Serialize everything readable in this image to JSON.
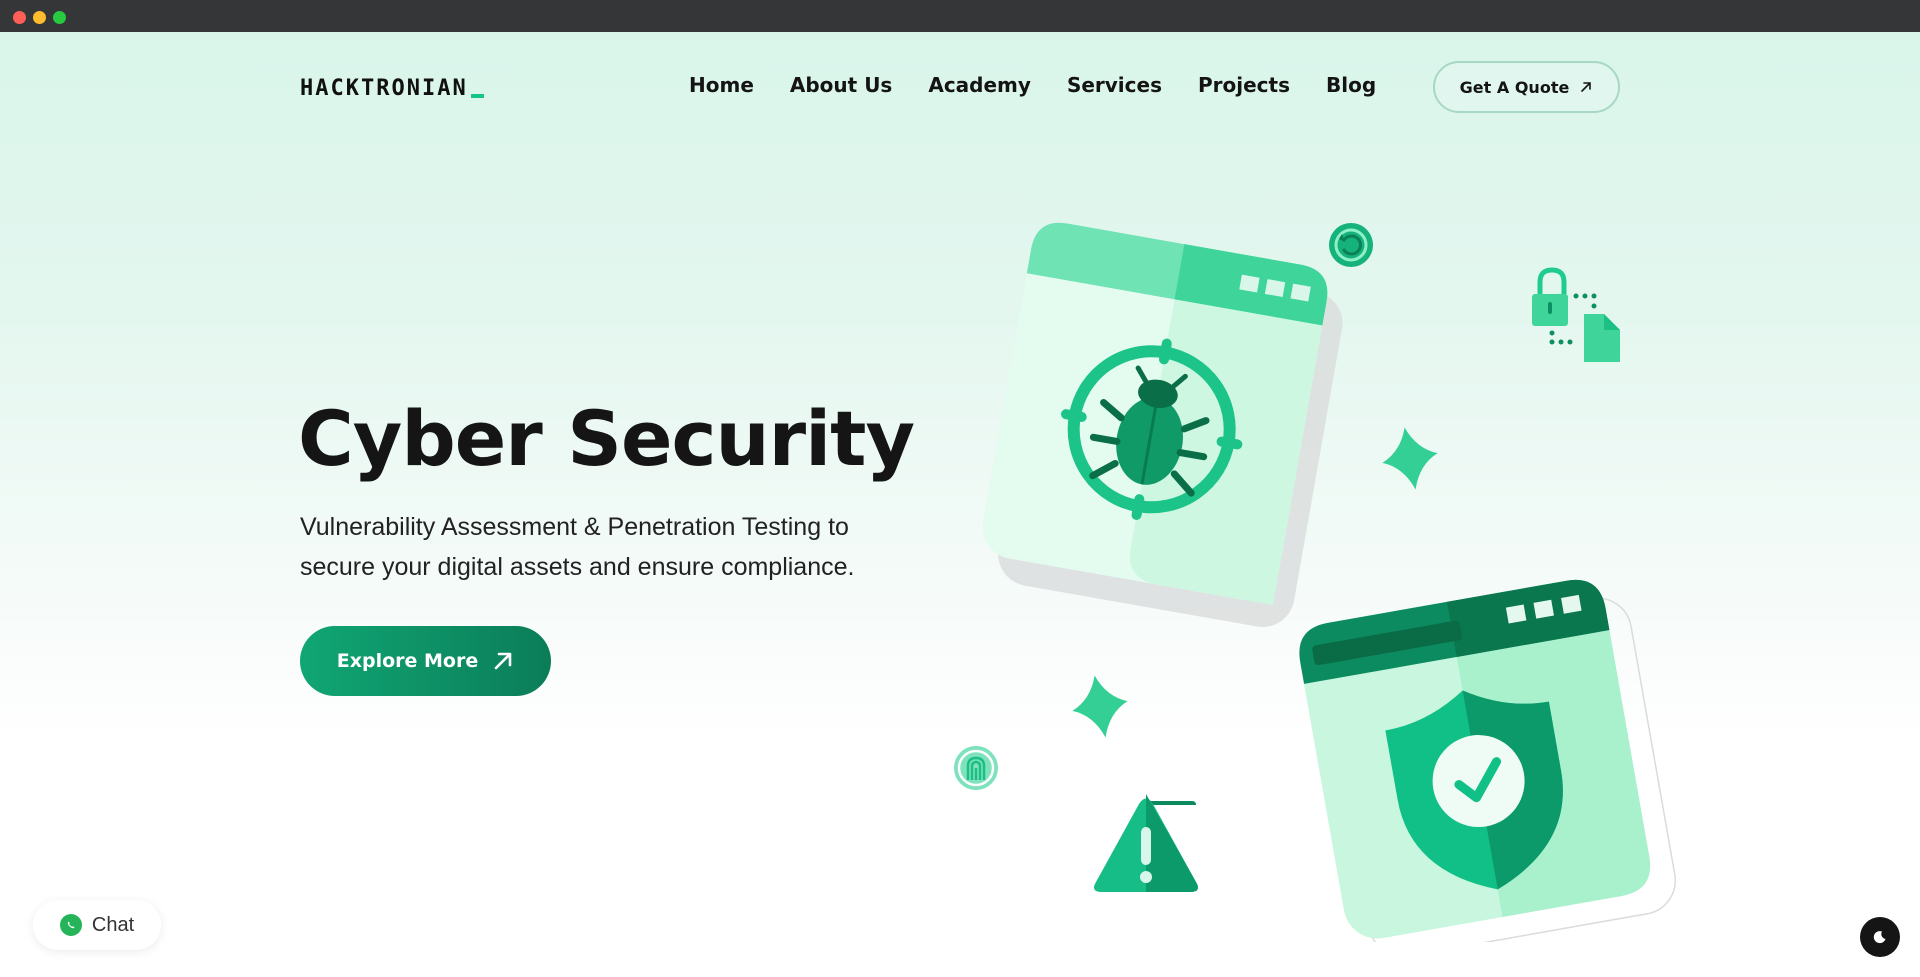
{
  "window": {
    "controls": [
      "close",
      "minimize",
      "maximize"
    ]
  },
  "header": {
    "logo_text": "HACKTRONIAN",
    "nav": [
      {
        "label": "Home"
      },
      {
        "label": "About Us"
      },
      {
        "label": "Academy"
      },
      {
        "label": "Services"
      },
      {
        "label": "Projects"
      },
      {
        "label": "Blog"
      }
    ],
    "cta_label": "Get A Quote"
  },
  "hero": {
    "title": "Cyber Security",
    "subtitle": "Vulnerability Assessment & Penetration Testing to secure your digital assets and ensure compliance.",
    "button_label": "Explore More"
  },
  "illustration": {
    "icons": [
      "bug-target-window-icon",
      "shield-check-window-icon",
      "lock-document-icon",
      "sparkle-icon",
      "warning-icon",
      "fingerprint-icon",
      "refresh-icon"
    ]
  },
  "widgets": {
    "chat_label": "Chat"
  },
  "colors": {
    "accent": "#10a674",
    "accent_dark": "#0b7d58",
    "accent_light": "#2fd69e",
    "text": "#141414"
  }
}
